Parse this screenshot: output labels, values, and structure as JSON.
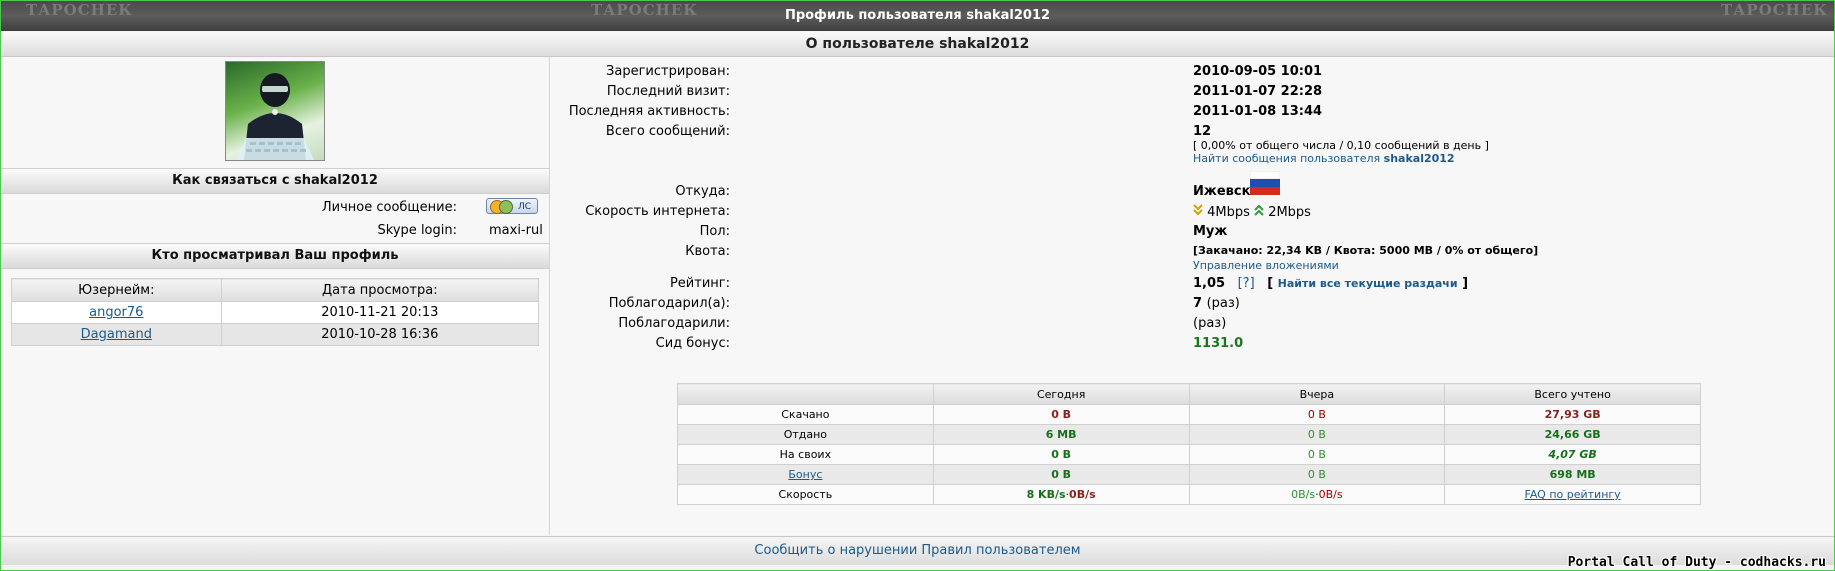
{
  "header": {
    "title": "Профиль пользователя shakal2012",
    "watermark": "ТАРОСНЕК"
  },
  "subheader": {
    "title": "О пользователе shakal2012"
  },
  "left": {
    "contact_title": "Как связаться с shakal2012",
    "pm_label": "Личное сообщение:",
    "pm_button": "ЛС",
    "skype_label": "Skype login:",
    "skype_value": "maxi-rul",
    "viewers_title": "Кто просматривал Ваш профиль",
    "viewers_headers": [
      "Юзернейм:",
      "Дата просмотра:"
    ],
    "viewers": [
      {
        "user": "angor76",
        "date": "2010-11-21 20:13"
      },
      {
        "user": "Dagamand",
        "date": "2010-10-28 16:36"
      }
    ]
  },
  "profile": {
    "registered_label": "Зарегистрирован:",
    "registered_value": "2010-09-05 10:01",
    "last_visit_label": "Последний визит:",
    "last_visit_value": "2011-01-07 22:28",
    "last_activity_label": "Последняя активность:",
    "last_activity_value": "2011-01-08 13:44",
    "posts_label": "Всего сообщений:",
    "posts_value": "12",
    "posts_stats": "[ 0,00% от общего числа / 0,10 сообщений в день ]",
    "posts_link_prefix": "Найти сообщения пользователя",
    "posts_link_user": "shakal2012",
    "from_label": "Откуда:",
    "from_value": "Ижевск",
    "speed_label": "Скорость интернета:",
    "speed_down": "4Mbps",
    "speed_up": "2Mbps",
    "gender_label": "Пол:",
    "gender_value": "Муж",
    "quota_label": "Квота:",
    "quota_value": "[Закачано: 22,34 KB / Квота: 5000 MB / 0% от общего]",
    "quota_link": "Управление вложениями",
    "rating_label": "Рейтинг:",
    "rating_value": "1,05",
    "rating_help": "[?]",
    "rating_link": "Найти все текущие раздачи",
    "thanked_label": "Поблагодарил(а):",
    "thanked_value": "7",
    "thanked_unit": "(раз)",
    "thanks_received_label": "Поблагодарили:",
    "thanks_received_value": "(раз)",
    "seed_bonus_label": "Сид бонус:",
    "seed_bonus_value": "1131.0"
  },
  "stats": {
    "headers": [
      "",
      "Сегодня",
      "Вчера",
      "Всего учтено"
    ],
    "rows": [
      {
        "label": "Скачано",
        "today": "0 B",
        "yesterday": "0 B",
        "total": "27,93 GB"
      },
      {
        "label": "Отдано",
        "today": "6 MB",
        "yesterday": "0 B",
        "total": "24,66 GB"
      },
      {
        "label": "На своих",
        "today": "0 B",
        "yesterday": "0 B",
        "total": "4,07 GB"
      },
      {
        "label": "Бонус",
        "today": "0 B",
        "yesterday": "0 B",
        "total": "698 MB"
      },
      {
        "label": "Скорость",
        "today_up": "8 KB/s",
        "today_sep": "·",
        "today_down": "0B/s",
        "yesterday_up": "0B/s",
        "yesterday_sep": "·",
        "yesterday_down": "0B/s",
        "total": "FAQ по рейтингу"
      }
    ]
  },
  "footer": {
    "report_link": "Сообщить о нарушении Правил пользователем",
    "credit": "Portal Call of Duty - codhacks.ru"
  },
  "colors": {
    "border_accent": "#4cc84c",
    "link": "#1d5a8a",
    "bonus_green": "#18791c",
    "header_dark": "#4a4a4a"
  },
  "icons": [
    "russia-flag-icon",
    "download-arrow-icon",
    "upload-arrow-icon",
    "pm-icon"
  ]
}
